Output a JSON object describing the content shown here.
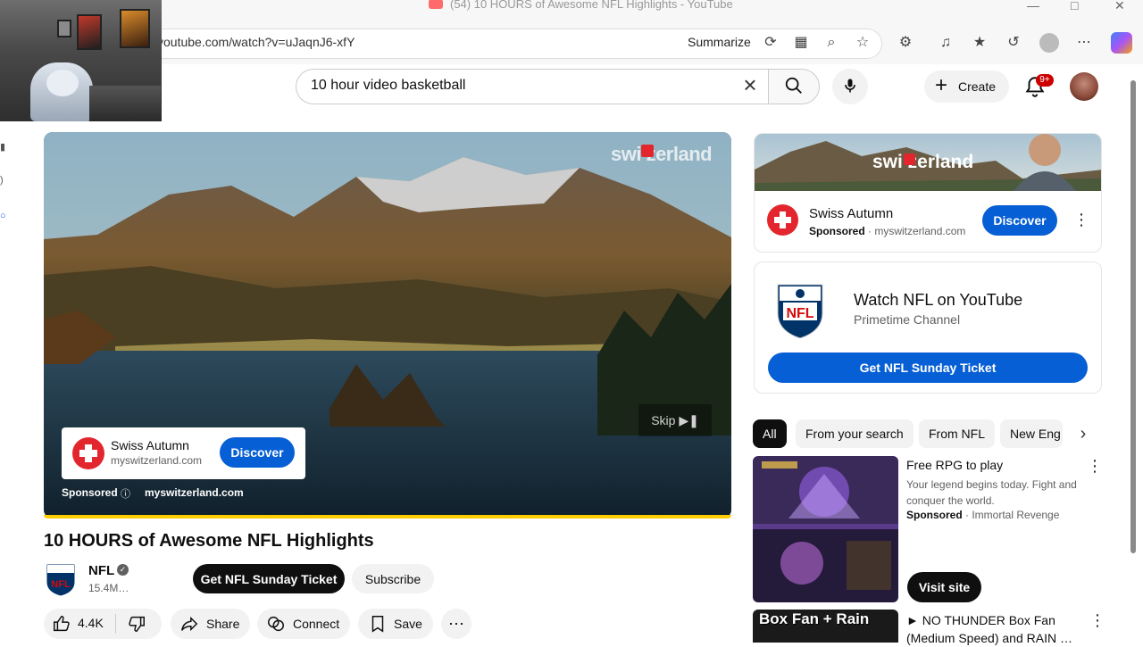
{
  "browser": {
    "window_title": "(54) 10 HOURS of Awesome NFL Highlights - YouTube",
    "url": "youtube.com/watch?v=uJaqnJ6-xfY",
    "summarize_label": "Summarize"
  },
  "header": {
    "search_value": "10 hour video basketball",
    "create_label": "Create",
    "notifications_badge": "9+"
  },
  "player": {
    "watermark": "swi  zerland",
    "skip_label": "Skip",
    "ad_card": {
      "name": "Swiss Autumn",
      "url": "myswitzerland.com",
      "cta": "Discover"
    },
    "sponsored_label": "Sponsored",
    "sponsored_url": "myswitzerland.com",
    "progress": 1.0
  },
  "video": {
    "title": "10 HOURS of Awesome NFL Highlights",
    "channel": "NFL",
    "subscribers": "15.4M…",
    "ticket_button": "Get NFL Sunday Ticket",
    "subscribe_button": "Subscribe",
    "likes": "4.4K",
    "share_label": "Share",
    "connect_label": "Connect",
    "save_label": "Save"
  },
  "sidebar": {
    "sponsor_card": {
      "banner_logo": "swi  zerland",
      "name": "Swiss Autumn",
      "sponsored": "Sponsored",
      "url": "· myswitzerland.com",
      "cta": "Discover"
    },
    "nfl_card": {
      "title": "Watch NFL on YouTube",
      "subtitle": "Primetime Channel",
      "cta": "Get NFL Sunday Ticket"
    },
    "chips": [
      "All",
      "From your search",
      "From NFL",
      "New Eng"
    ],
    "rpg_ad": {
      "title": "Free RPG to play",
      "description": "Your legend begins today. Fight and conquer the world.",
      "sponsored": "Sponsored",
      "advertiser": "· Immortal Revenge",
      "cta": "Visit site"
    },
    "next_video": {
      "thumb_text": "Box Fan + Rain",
      "title": "► NO THUNDER Box Fan (Medium Speed) and RAIN …"
    }
  },
  "colors": {
    "accent_blue": "#065fd4",
    "youtube_red": "#cc0000",
    "progress_yellow": "#ffcc00",
    "swiss_red": "#e3262e"
  },
  "icons": [
    "search-icon",
    "mic-icon",
    "plus-icon",
    "bell-icon",
    "thumb-up-icon",
    "thumb-down-icon",
    "share-icon",
    "connect-icon",
    "save-icon",
    "more-icon",
    "chevron-right-icon",
    "close-icon",
    "verified-icon",
    "skip-icon"
  ]
}
